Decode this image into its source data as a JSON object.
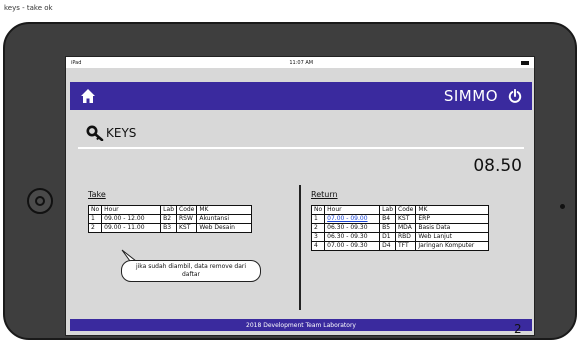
{
  "caption": "keys - take ok",
  "status_bar": {
    "left": "iPad",
    "time": "11:07 AM"
  },
  "navbar": {
    "brand": "SIMMO",
    "home_icon": "home-icon",
    "power_icon": "power-icon"
  },
  "page": {
    "title": "KEYS",
    "title_icon": "key-icon",
    "clock": "08.50"
  },
  "take": {
    "label": "Take",
    "columns": [
      "No",
      "Hour",
      "Lab",
      "Code",
      "MK"
    ],
    "rows": [
      [
        "1",
        "09.00 - 12.00",
        "B2",
        "RSW",
        "Akuntansi"
      ],
      [
        "2",
        "09.00 - 11.00",
        "B3",
        "KST",
        "Web Desain"
      ]
    ],
    "note": "jika sudah diambil, data remove dari daftar"
  },
  "return": {
    "label": "Return",
    "columns": [
      "No",
      "Hour",
      "Lab",
      "Code",
      "MK"
    ],
    "rows": [
      [
        "1",
        "07.00 - 09.00",
        "B4",
        "KST",
        "ERP"
      ],
      [
        "2",
        "06.30 - 09.30",
        "B5",
        "MDA",
        "Basis Data"
      ],
      [
        "3",
        "06.30 - 09.30",
        "D1",
        "RBD",
        "Web Lanjut"
      ],
      [
        "4",
        "07.00 - 09.30",
        "D4",
        "TFT",
        "Jaringan Komputer"
      ]
    ]
  },
  "footer": "2018 Development Team Laboratory",
  "colors": {
    "navbar": "#3a2a9e",
    "screen_bg": "#d8d8d8",
    "link": "#1a44d6"
  }
}
